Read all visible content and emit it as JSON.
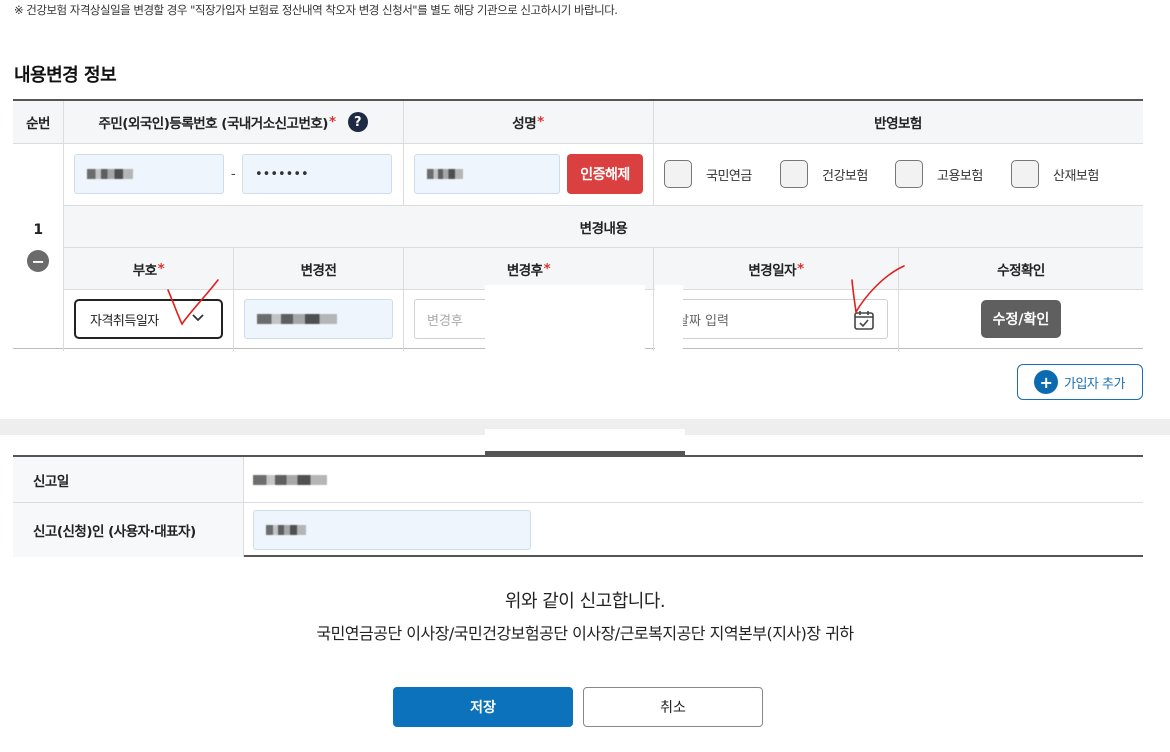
{
  "notice": "※ 건강보험 자격상실일을 변경할 경우 \"직장가입자 보험료 정산내역 착오자 변경 신청서\"를 별도 해당 기관으로 신고하시기 바랍니다.",
  "section_title": "내용변경 정보",
  "table": {
    "headers": {
      "seq": "순번",
      "id_number": "주민(외국인)등록번호 (국내거소신고번호)",
      "name": "성명",
      "insurance": "반영보험"
    },
    "help_icon": "?",
    "required_mark": "*",
    "row": {
      "seq": "1",
      "minus_icon": "−",
      "id_sep": "-",
      "id_back_mask": "•••••••",
      "auth_cancel_label": "인증해제",
      "insurances": [
        "국민연금",
        "건강보험",
        "고용보험",
        "산재보험"
      ]
    },
    "change": {
      "title": "변경내용",
      "headers": {
        "code": "부호",
        "before": "변경전",
        "after": "변경후",
        "date": "변경일자",
        "confirm": "수정확인"
      },
      "code_value": "자격취득일자",
      "after_placeholder": "변경후",
      "date_placeholder": "날짜 입력",
      "confirm_label": "수정/확인"
    }
  },
  "add_member_label": "가입자 추가",
  "report": {
    "date_label": "신고일",
    "applicant_label": "신고(신청)인 (사용자·대표자)"
  },
  "declaration": {
    "line1": "위와 같이 신고합니다.",
    "line2": "국민연금공단 이사장/국민건강보험공단 이사장/근로복지공단 지역본부(지사)장 귀하"
  },
  "buttons": {
    "save": "저장",
    "cancel": "취소"
  },
  "icons": {
    "help": "question-circle-icon",
    "minus": "minus-circle-icon",
    "chevron": "chevron-down-icon",
    "calendar": "calendar-check-icon",
    "plus": "plus-circle-icon"
  },
  "colors": {
    "primary": "#0b72bb",
    "danger": "#d9403f",
    "required": "#d93434",
    "annotation": "#e0201e"
  }
}
